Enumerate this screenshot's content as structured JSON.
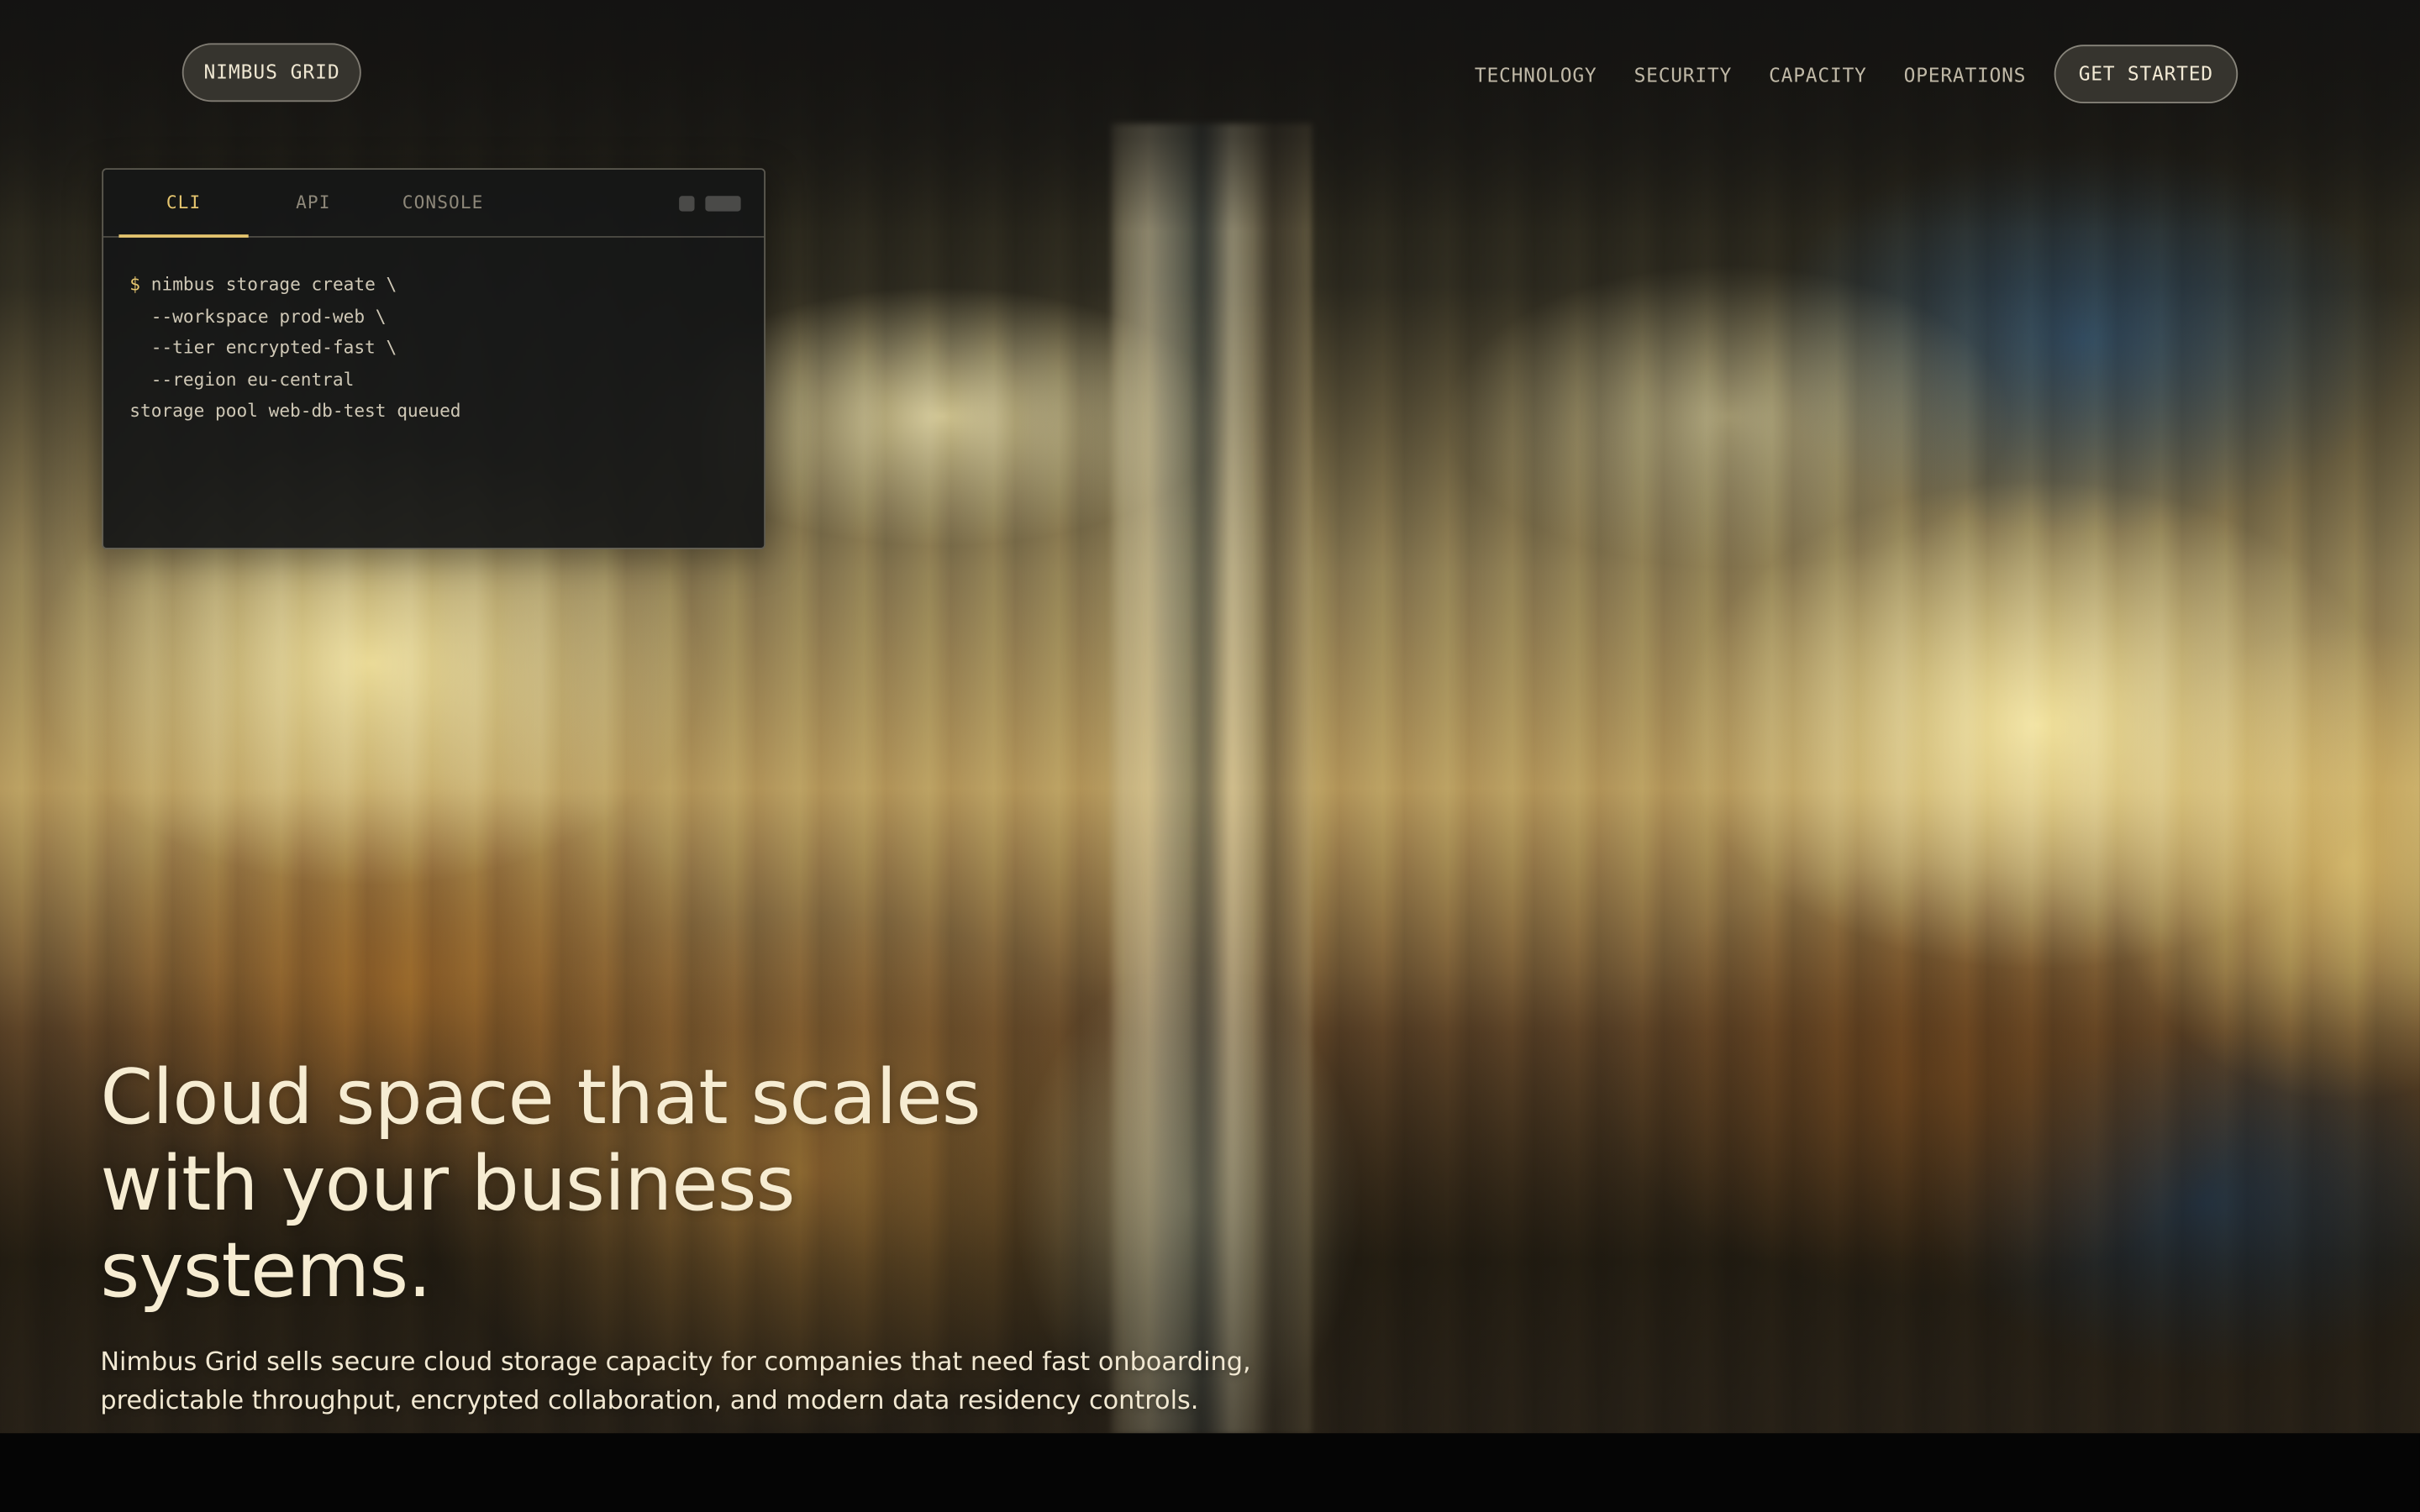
{
  "brand": {
    "label": "NIMBUS GRID"
  },
  "nav": {
    "items": [
      {
        "label": "TECHNOLOGY"
      },
      {
        "label": "SECURITY"
      },
      {
        "label": "CAPACITY"
      },
      {
        "label": "OPERATIONS"
      }
    ],
    "cta_label": "GET STARTED"
  },
  "terminal": {
    "tabs": [
      {
        "label": "CLI",
        "active": true
      },
      {
        "label": "API",
        "active": false
      },
      {
        "label": "CONSOLE",
        "active": false
      }
    ],
    "prompt_symbol": "$",
    "lines": [
      "nimbus storage create \\",
      "  --workspace prod-web \\",
      "  --tier encrypted-fast \\",
      "  --region eu-central",
      "storage pool web-db-test queued"
    ]
  },
  "hero": {
    "headline_lines": [
      "Cloud space that scales",
      "with your business",
      "systems."
    ],
    "subcopy_lines": [
      "Nimbus Grid sells secure cloud storage capacity for companies that need fast onboarding,",
      "predictable throughput, encrypted collaboration, and modern data residency controls."
    ]
  },
  "colors": {
    "accent": "#e6c66f",
    "headline": "#f6ecd2",
    "nav_text": "#bfb8a6",
    "terminal_bg": "#161717"
  },
  "icons": {
    "window_controls": [
      "minimize-control-icon",
      "window-control-pill-icon"
    ]
  }
}
